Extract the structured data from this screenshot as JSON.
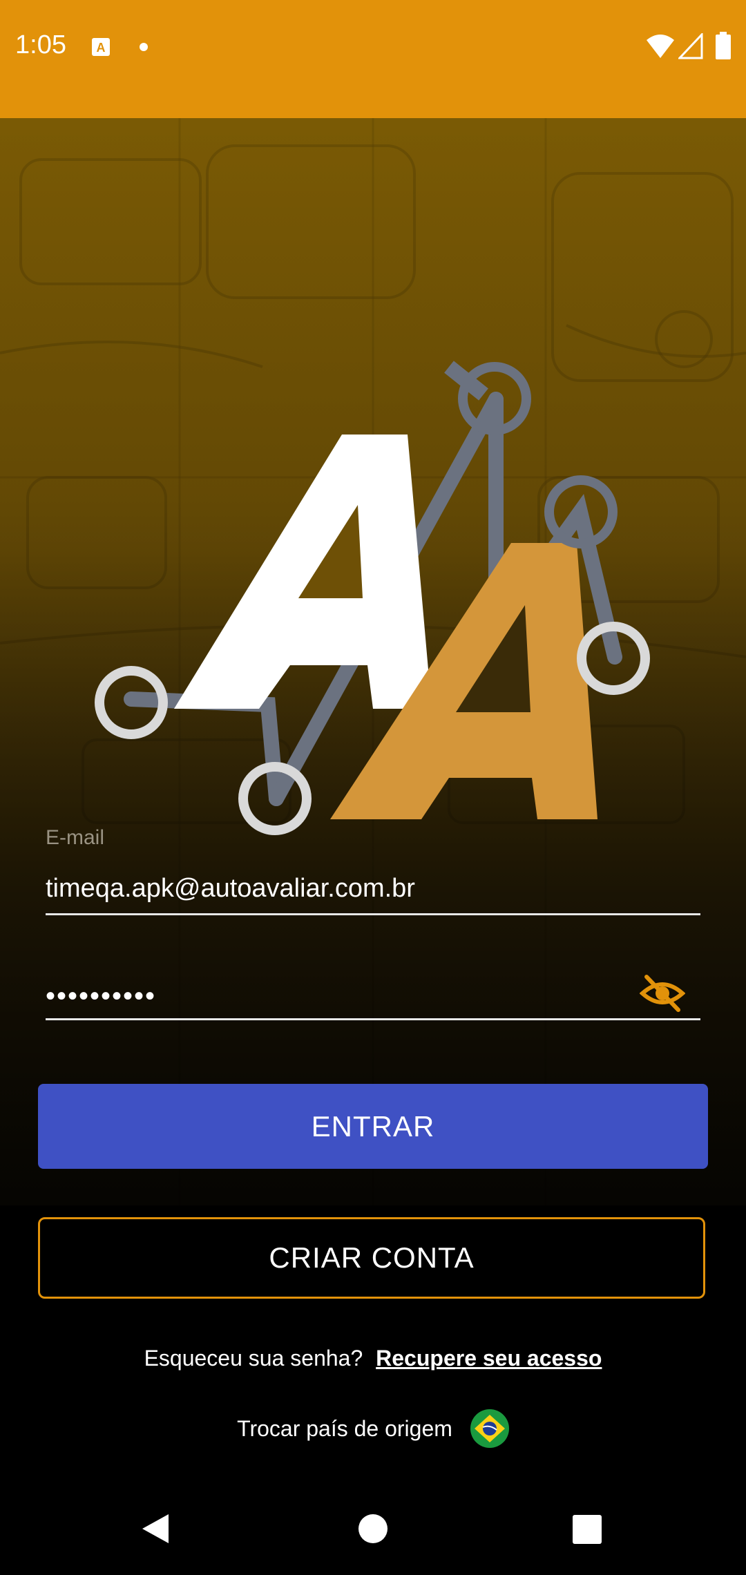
{
  "status_bar": {
    "time": "1:05",
    "icons": [
      "app-notification-icon",
      "dot-icon",
      "wifi-icon",
      "signal-icon",
      "battery-icon"
    ],
    "background": "#E2920A"
  },
  "logo": {
    "name": "AutoAvaliar",
    "letters": [
      "A",
      "A"
    ],
    "colors": {
      "primary_letter": "#FFFFFF",
      "secondary_letter": "#D4963A",
      "network": "#6B7280",
      "nodes": "#D9D9D9"
    }
  },
  "login_form": {
    "email_label": "E-mail",
    "email_value": "timeqa.apk@autoavaliar.com.br",
    "password_value": "••••••••••",
    "password_toggle_icon": "eye-off-icon",
    "accent_color": "#E2920A"
  },
  "buttons": {
    "login_label": "ENTRAR",
    "login_color": "#3F51C4",
    "create_account_label": "CRIAR CONTA",
    "create_account_border": "#E2920A"
  },
  "footer": {
    "forgot_text": "Esqueceu sua senha?",
    "recover_link": "Recupere seu acesso",
    "change_country_text": "Trocar país de origem",
    "country_flag_icon": "brazil-flag-icon"
  },
  "nav_bar": {
    "icons": [
      "back-icon",
      "home-icon",
      "recents-icon"
    ]
  }
}
